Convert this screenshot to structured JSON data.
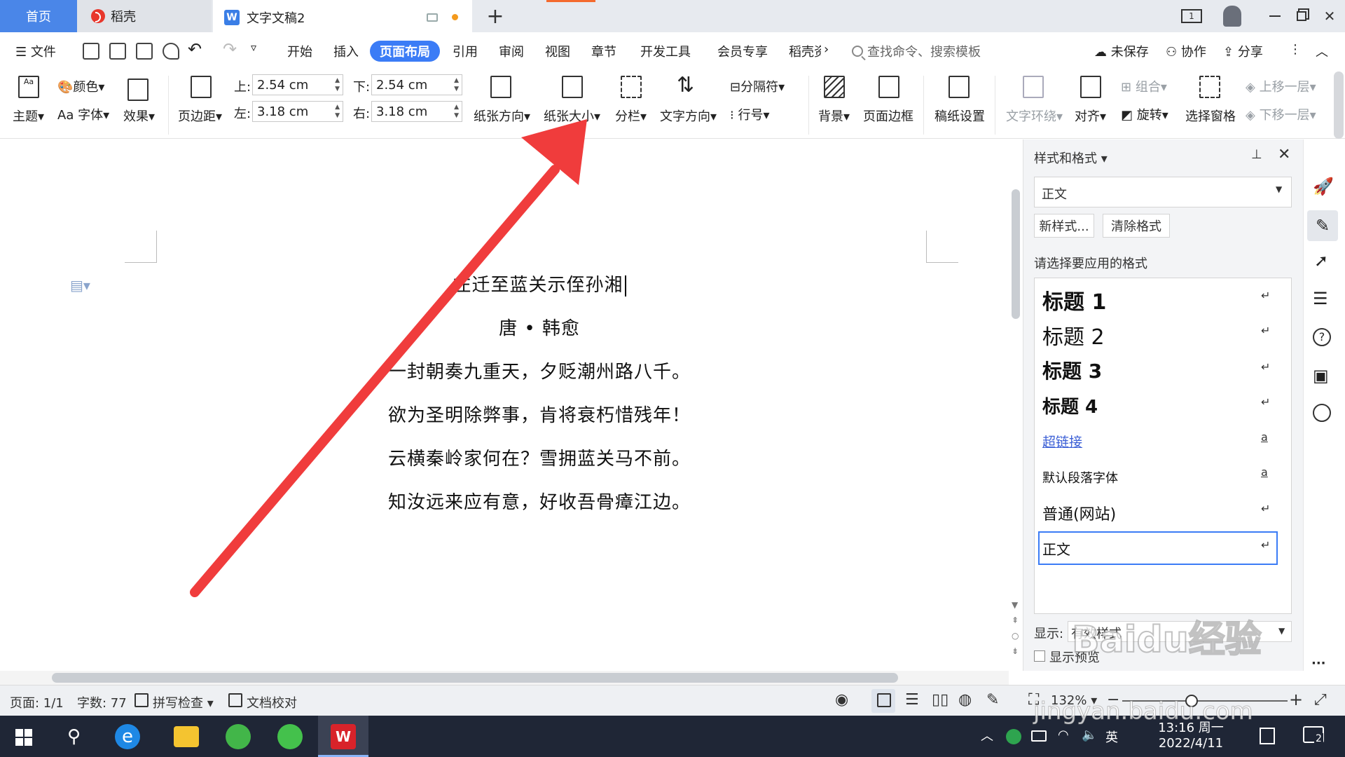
{
  "titlebar": {
    "tab_home": "首页",
    "tab_docer": "稻壳",
    "tab_doc": "文字文稿2",
    "add_tab": "+",
    "page_indicator": "1"
  },
  "menu": {
    "file": "文件",
    "items": [
      "开始",
      "插入",
      "页面布局",
      "引用",
      "审阅",
      "视图",
      "章节",
      "开发工具",
      "会员专享",
      "稻壳资"
    ],
    "search_placeholder": "查找命令、搜索模板",
    "unsaved": "未保存",
    "collab": "协作",
    "share": "分享"
  },
  "ribbon": {
    "theme": "主题",
    "color": "颜色",
    "font": "字体",
    "font_prefix": "Aa",
    "effect": "效果",
    "margins": "页边距",
    "top_label": "上:",
    "top_value": "2.54 cm",
    "bottom_label": "下:",
    "bottom_value": "2.54 cm",
    "left_label": "左:",
    "left_value": "3.18 cm",
    "right_label": "右:",
    "right_value": "3.18 cm",
    "orientation": "纸张方向",
    "paper_size": "纸张大小",
    "columns": "分栏",
    "text_direction": "文字方向",
    "separator": "分隔符",
    "line_number": "行号",
    "background": "背景",
    "page_border": "页面边框",
    "manuscript": "稿纸设置",
    "text_wrap": "文字环绕",
    "align": "对齐",
    "group": "组合",
    "rotate": "旋转",
    "select_pane": "选择窗格",
    "bring_forward": "上移一层",
    "send_backward": "下移一层"
  },
  "document": {
    "title": "左迁至蓝关示侄孙湘",
    "author": "唐 • 韩愈",
    "lines": [
      "一封朝奏九重天，夕贬潮州路八千。",
      "欲为圣明除弊事，肯将衰朽惜残年！",
      "云横秦岭家何在？雪拥蓝关马不前。",
      "知汝远来应有意，好收吾骨瘴江边。"
    ]
  },
  "styles_pane": {
    "header": "样式和格式",
    "current_style": "正文",
    "new_style": "新样式...",
    "clear_format": "清除格式",
    "choose_label": "请选择要应用的格式",
    "items": [
      {
        "label": "标题 1",
        "marker": "↵"
      },
      {
        "label": "标题 2",
        "marker": "↵"
      },
      {
        "label": "标题 3",
        "marker": "↵"
      },
      {
        "label": "标题 4",
        "marker": "↵"
      },
      {
        "label": "超链接",
        "marker": "a"
      },
      {
        "label": "默认段落字体",
        "marker": "a"
      },
      {
        "label": "普通(网站)",
        "marker": "↵"
      },
      {
        "label": "正文",
        "marker": "↵"
      }
    ],
    "show_label": "显示:",
    "show_value": "有效样式",
    "preview_label": "显示预览"
  },
  "statusbar": {
    "page": "页面: 1/1",
    "words": "字数: 77",
    "spell_check": "拼写检查",
    "doc_check": "文档校对",
    "zoom": "132%",
    "zoom_minus": "−",
    "zoom_plus": "+",
    "zoom_level": 0.42
  },
  "taskbar": {
    "ime": "英",
    "time": "13:16 周一",
    "date": "2022/4/11",
    "notifications": "2"
  },
  "watermark": {
    "brand": "Baidu经验",
    "url": "jingyan.baidu.com"
  },
  "colors": {
    "accent": "#3b7cf6",
    "home_tab": "#4a86e8",
    "arrow": "#f03c3c",
    "taskbar": "#1f2636"
  }
}
